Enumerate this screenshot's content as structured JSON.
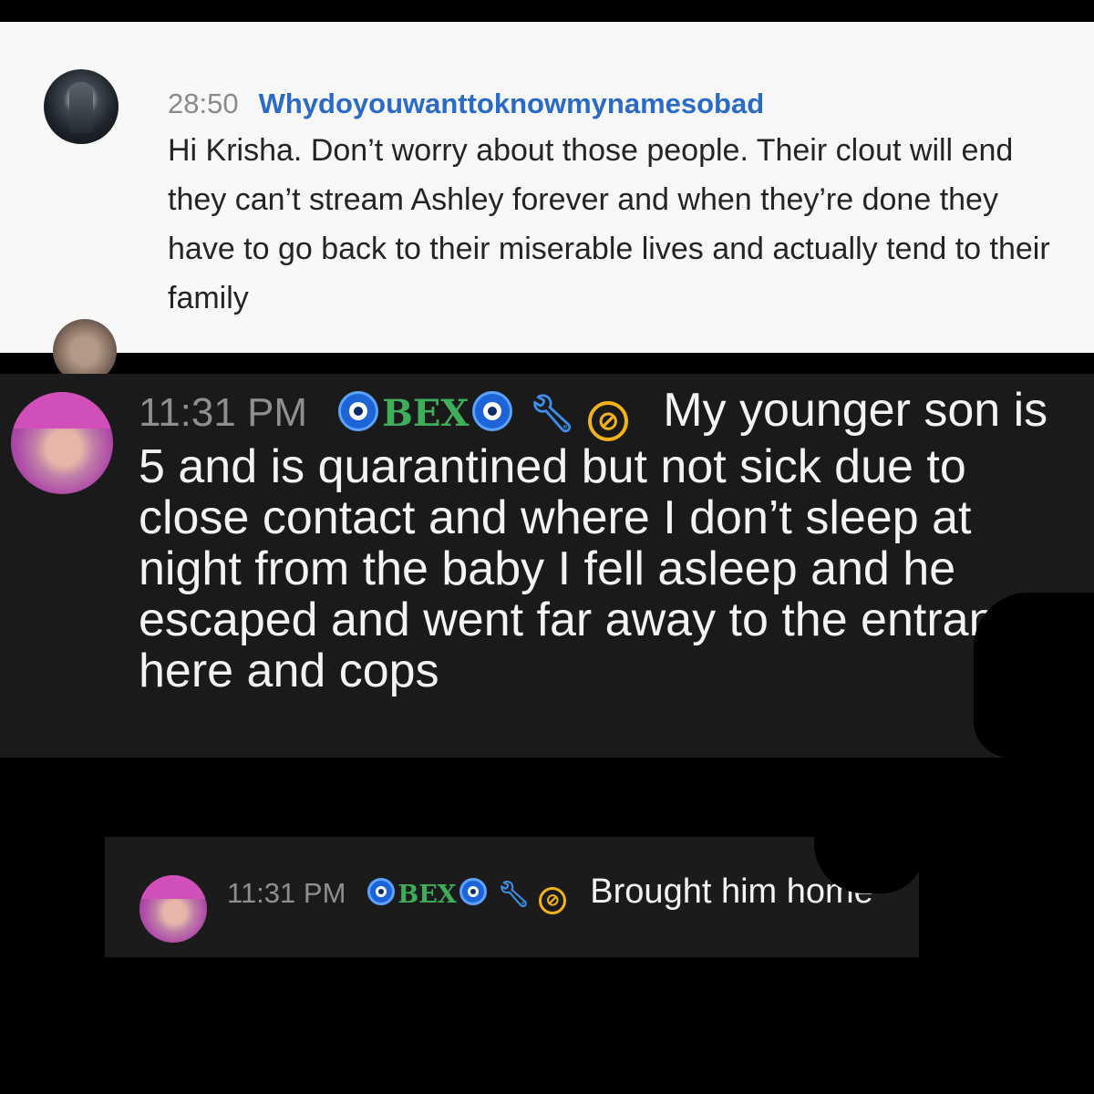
{
  "top_message": {
    "timestamp": "28:50",
    "author": "Whydoyouwanttoknowmynamesobad",
    "text": "Hi Krisha. Don’t worry about those people. Their clout will end they can’t stream Ashley forever and when they’re done they have to go back to their miserable lives and actually tend to their family"
  },
  "middle_message": {
    "timestamp": "11:31 PM",
    "name": "BEX",
    "text": "My younger son is 5 and is quarantined but not sick due to close contact and where I don’t sleep at night from the baby I fell asleep and he escaped and went far away to the entrance here and cops"
  },
  "bottom_message": {
    "timestamp": "11:31 PM",
    "name": "BEX",
    "text": "Brought him home"
  },
  "colors": {
    "author_link": "#2a6ac9",
    "bex_green": "#3fae5a",
    "eye_blue": "#1d64d8",
    "wrench_blue": "#3d8ee8",
    "badge_yellow": "#f2b31a"
  },
  "icons": [
    "nazar-eye-icon",
    "wrench-icon",
    "no-symbol-icon"
  ]
}
